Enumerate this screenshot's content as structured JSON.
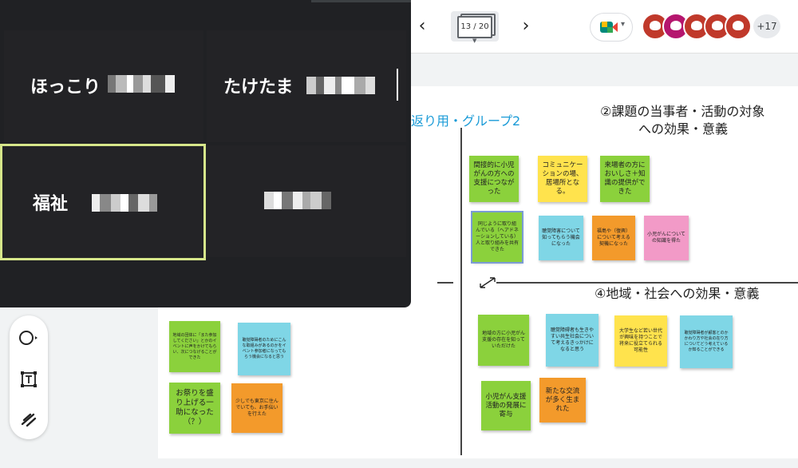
{
  "toolbar": {
    "prev_label": "‹",
    "next_label": "›",
    "frame_counter": "13 / 20",
    "participant_count": "+17"
  },
  "participants": [
    {
      "name": "ほっこり"
    },
    {
      "name": "たけたま"
    },
    {
      "name": "福祉"
    },
    {
      "name": ""
    }
  ],
  "board": {
    "title_partial": "返り用・グループ2",
    "q2_heading_line1": "②課題の当事者・活動の対象",
    "q2_heading_line2": "への効果・意義",
    "q4_heading": "④地域・社会への効果・意義",
    "notes_q2_row1": [
      {
        "text": "間接的に小児がんの方への支援につながった",
        "color": "#8bd13c"
      },
      {
        "text": "コミュニケーションの場、居場所となる。",
        "color": "#ffe34d"
      },
      {
        "text": "来場者の方においしさ＋知識の提供ができた",
        "color": "#8bd13c"
      }
    ],
    "notes_q2_row2": [
      {
        "text": "同じように取り組んでいる（ヘアドネーションしている）人と取り組みを共有できた",
        "color": "#8bd13c"
      },
      {
        "text": "聴覚障害について知ってもらう機会になった",
        "color": "#7fd6e6"
      },
      {
        "text": "福島や（復興）について考える契機になった",
        "color": "#f39a2b"
      },
      {
        "text": "小児がんについての知識を得た",
        "color": "#f29ac7"
      }
    ],
    "notes_q4_row1": [
      {
        "text": "地域の方に小児がん支援の存在を知っていただけた",
        "color": "#8bd13c"
      },
      {
        "text": "聴覚障碍者も生きやすい共生社会について考えるきっかけになると思う",
        "color": "#7fd6e6"
      },
      {
        "text": "大学生など若い世代が興味を持つことで将来に役立てられる可能性",
        "color": "#ffe34d"
      },
      {
        "text": "聴覚障碍者が顧客とのかかわり方や社会の在り方についてどう考えているか知ることができる",
        "color": "#7fd6e6"
      }
    ],
    "notes_q4_row2": [
      {
        "text": "小児がん支援活動の発展に寄与",
        "color": "#8bd13c"
      },
      {
        "text": "新たな交流が多く生まれた",
        "color": "#f39a2b"
      }
    ],
    "notes_left_row1": [
      {
        "text": "地域の団体に「また参加してください」とかのイベントに声をかけてもらい、次につなげることができた",
        "color": "#8bd13c"
      },
      {
        "text": "聴覚障碍者のためにこんな取組みがあるのかをイベント参加者になってもらう機会になると思う",
        "color": "#7fd6e6"
      }
    ],
    "notes_left_row2": [
      {
        "text": "お祭りを盛り上げる一助になった（？）",
        "color": "#8bd13c"
      },
      {
        "text": "少しでも東京に住んでいても、お手伝いを行えた",
        "color": "#f39a2b"
      }
    ]
  }
}
